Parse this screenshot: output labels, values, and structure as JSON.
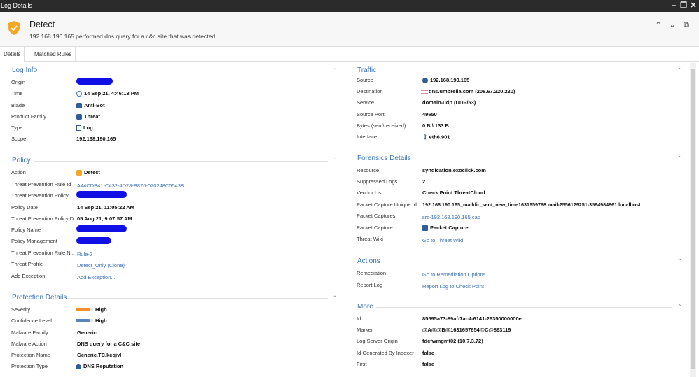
{
  "window": {
    "title": "Log Details"
  },
  "header": {
    "title": "Detect",
    "subtitle": "192.168.190.165 performed dns query for a c&c site that was detected"
  },
  "tabs": [
    {
      "label": "Details"
    },
    {
      "label": "Matched Rules"
    }
  ],
  "colors": {
    "accent": "#3b73b9",
    "severity_high": "#f2922f",
    "confidence_high": "#5b87b7",
    "redaction": "#1010e6"
  },
  "log_info": {
    "title": "Log Info",
    "rows": [
      {
        "label": "Origin",
        "value": ""
      },
      {
        "label": "Time",
        "value": "14 Sep 21, 4:46:13 PM",
        "icon": "clock-icon"
      },
      {
        "label": "Blade",
        "value": "Anti-Bot",
        "icon": "anti-bot-icon"
      },
      {
        "label": "Product Family",
        "value": "Threat",
        "icon": "threat-icon"
      },
      {
        "label": "Type",
        "value": "Log",
        "icon": "log-icon"
      },
      {
        "label": "Scope",
        "value": "192.168.190.165"
      }
    ]
  },
  "policy": {
    "title": "Policy",
    "rows": [
      {
        "label": "Action",
        "value": "Detect",
        "icon": "detect-icon"
      },
      {
        "label": "Threat Prevention Rule Id",
        "value": "A44CDB41-C432-4D28-B876-070248C55438"
      },
      {
        "label": "Threat Prevention Policy",
        "value": ""
      },
      {
        "label": "Policy Date",
        "value": "14 Sep 21, 11:05:22 AM"
      },
      {
        "label": "Threat Prevention Policy D...",
        "value": "05 Aug 21, 9:07:57 AM"
      },
      {
        "label": "Policy Name",
        "value": ""
      },
      {
        "label": "Policy Management",
        "value": ""
      },
      {
        "label": "Threat Prevention Rule N...",
        "value": "Rule-2"
      },
      {
        "label": "Threat Profile",
        "value": "Detect_Only (Clone)"
      },
      {
        "label": "Add Exception",
        "value": "Add Exception..."
      }
    ]
  },
  "protection": {
    "title": "Protection Details",
    "rows": [
      {
        "label": "Severity",
        "value": "High",
        "level": 0.8
      },
      {
        "label": "Confidence Level",
        "value": "High",
        "level": 0.8
      },
      {
        "label": "Malware Family",
        "value": "Generic"
      },
      {
        "label": "Malware Action",
        "value": "DNS query for a C&C site"
      },
      {
        "label": "Protection Name",
        "value": "Generic.TC.kcqivl"
      },
      {
        "label": "Protection Type",
        "value": "DNS Reputation",
        "icon": "dns-icon"
      }
    ]
  },
  "traffic": {
    "title": "Traffic",
    "rows": [
      {
        "label": "Source",
        "value": "192.168.190.165",
        "icon": "globe-icon"
      },
      {
        "label": "Destination",
        "value": "dns.umbrella.com (208.67.220.220)",
        "icon": "us-flag-icon"
      },
      {
        "label": "Service",
        "value": "domain-udp (UDP/53)"
      },
      {
        "label": "Source Port",
        "value": "49650"
      },
      {
        "label": "Bytes (sent\\received)",
        "value": "0 B \\ 133 B"
      },
      {
        "label": "Interface",
        "value": "eth6.901",
        "icon": "interface-arrow-icon"
      }
    ]
  },
  "forensics": {
    "title": "Forensics Details",
    "rows": [
      {
        "label": "Resource",
        "value": "syndication.exoclick.com"
      },
      {
        "label": "Suppressed Logs",
        "value": "2"
      },
      {
        "label": "Vendor List",
        "value": "Check Point ThreatCloud"
      },
      {
        "label": "Packet Capture Unique Id",
        "value": "192.168.190.165_maildir_sent_new_time1631659768.mail-2556129251-3564984861.localhost"
      },
      {
        "label": "Packet Captures",
        "value": "src-192.168.190.165.cap"
      },
      {
        "label": "Packet Capture",
        "value": "Packet Capture",
        "icon": "packet-capture-icon"
      },
      {
        "label": "Threat Wiki",
        "value": "Go to Threat Wiki"
      }
    ]
  },
  "actions": {
    "title": "Actions",
    "rows": [
      {
        "label": "Remediation",
        "value": "Go to Remediation Options"
      },
      {
        "label": "Report Log",
        "value": "Report Log to Check Point"
      }
    ]
  },
  "more": {
    "title": "More",
    "rows": [
      {
        "label": "Id",
        "value": "85595a73-89af-7ac4-6141-26350000000e"
      },
      {
        "label": "Marker",
        "value": "@A@@B@1631657654@C@863119"
      },
      {
        "label": "Log Server Origin",
        "value": "fdcfwmgmt02 (10.7.3.72)"
      },
      {
        "label": "Id Generated By Indexer",
        "value": "false"
      },
      {
        "label": "First",
        "value": "false"
      }
    ]
  }
}
